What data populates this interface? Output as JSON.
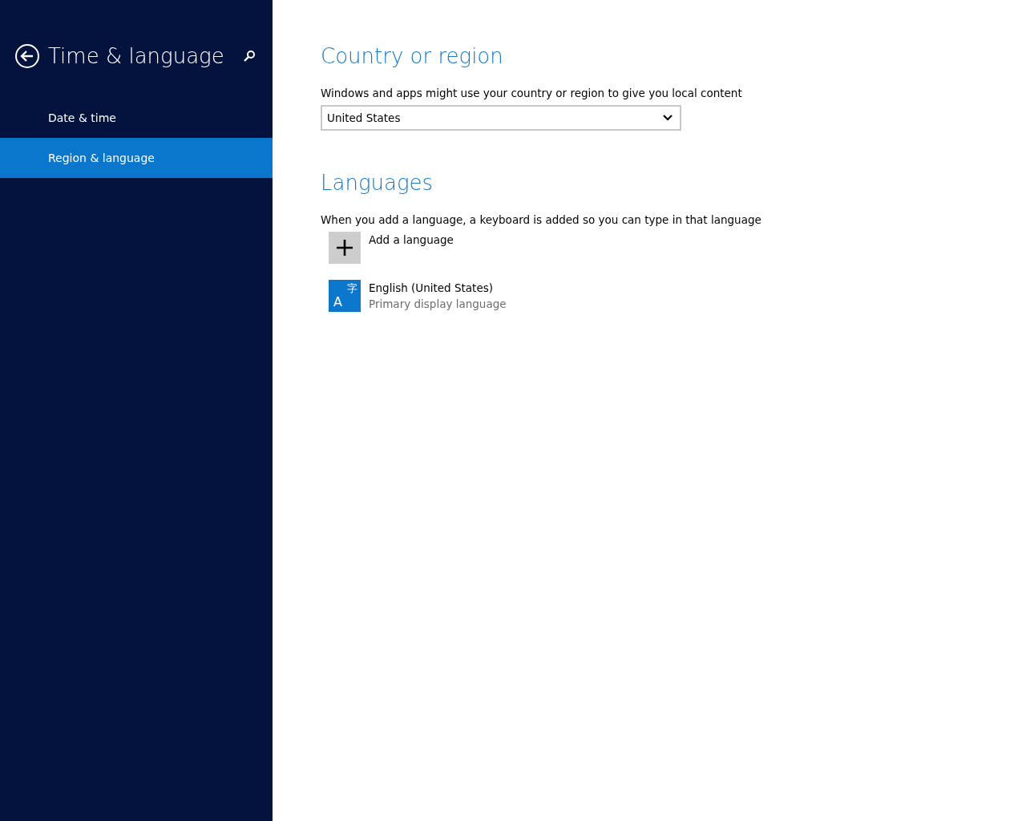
{
  "sidebar": {
    "title": "Time & language",
    "items": [
      {
        "label": "Date & time",
        "selected": false
      },
      {
        "label": "Region & language",
        "selected": true
      }
    ]
  },
  "country": {
    "heading": "Country or region",
    "description": "Windows and apps might use your country or region to give you local content",
    "value": "United States"
  },
  "languages": {
    "heading": "Languages",
    "description": "When you add a language, a keyboard is added so you can type in that language",
    "items": [
      {
        "kind": "add",
        "label": "Add a language"
      },
      {
        "kind": "language",
        "label": "English (United States)",
        "subtitle": "Primary display language",
        "icon_glyphs": [
          "A",
          "字"
        ]
      }
    ]
  }
}
